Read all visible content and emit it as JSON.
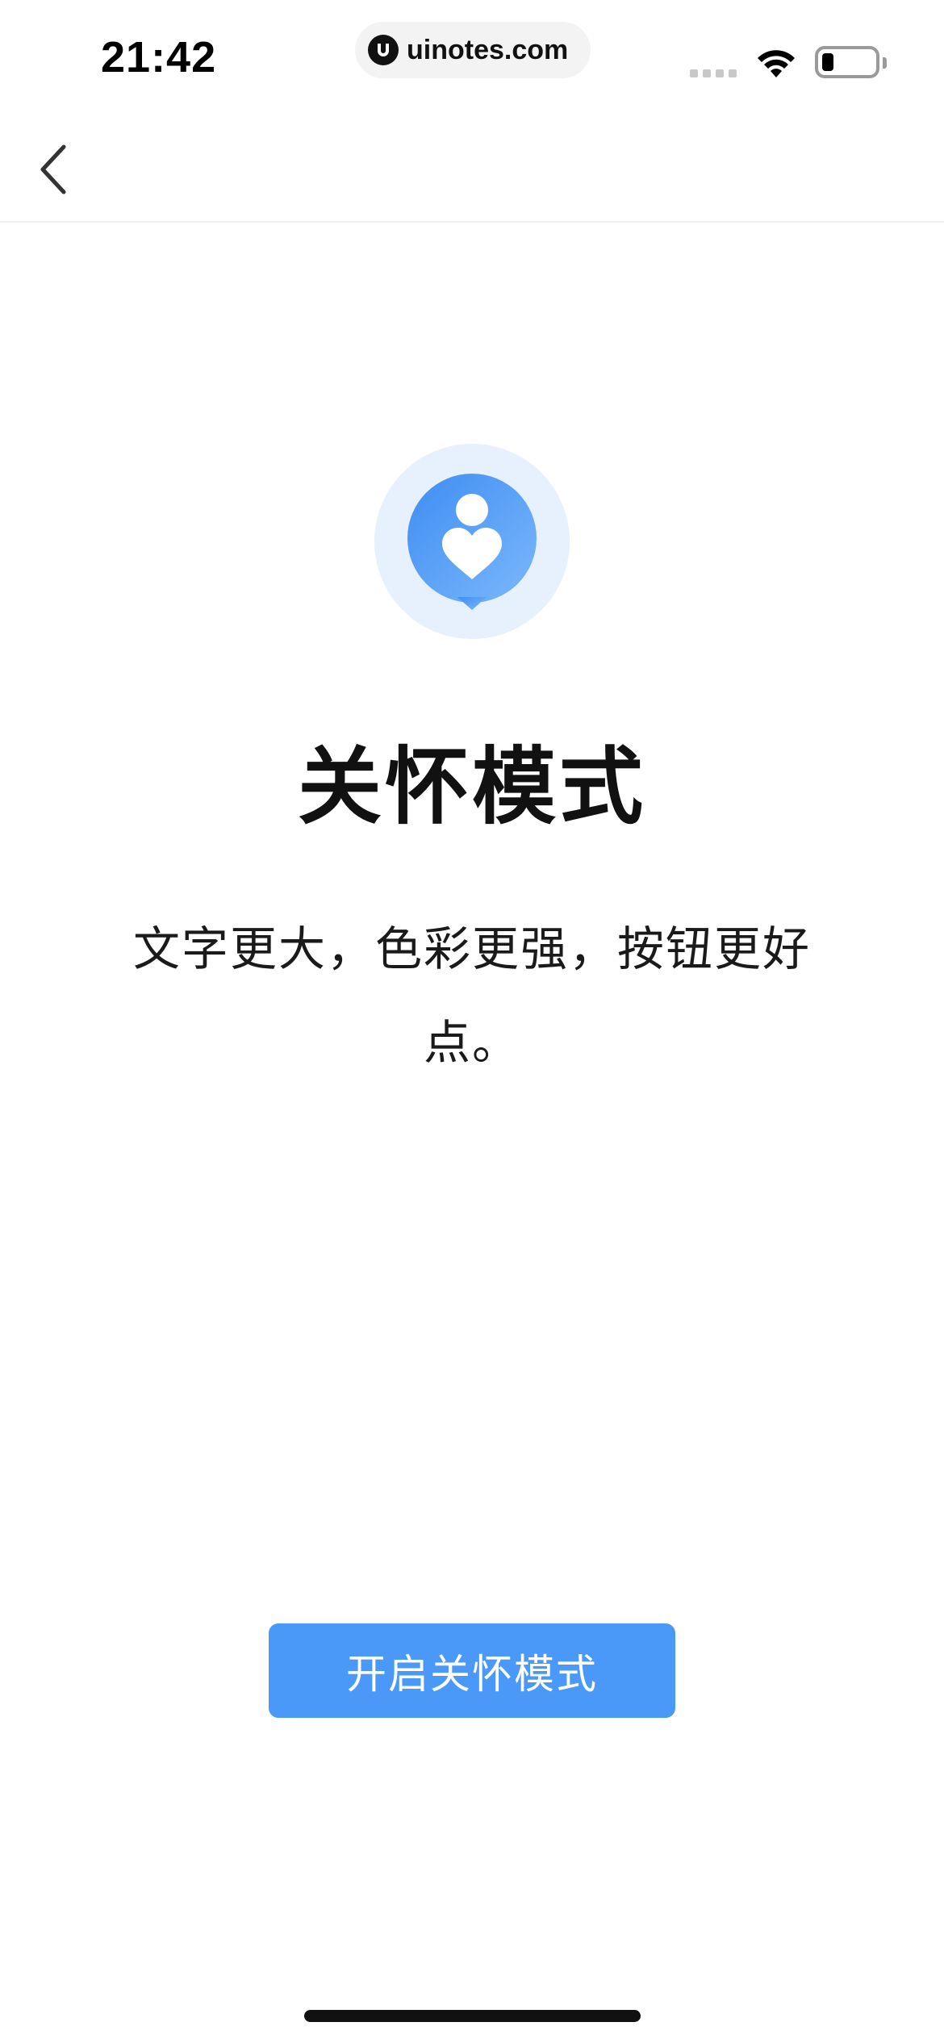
{
  "status_bar": {
    "time": "21:42",
    "watermark": "uinotes.com",
    "icons": [
      "signal-dots-icon",
      "wifi-icon",
      "battery-icon"
    ]
  },
  "nav": {
    "back_icon": "chevron-left-icon"
  },
  "hero": {
    "icon": "care-mode-heart-person-icon",
    "title": "关怀模式",
    "description": "文字更大，色彩更强，按钮更好点。"
  },
  "actions": {
    "enable_label": "开启关怀模式"
  },
  "colors": {
    "primary": "#4a98f7",
    "icon_bg": "#e6f1fd",
    "text": "#111111"
  }
}
